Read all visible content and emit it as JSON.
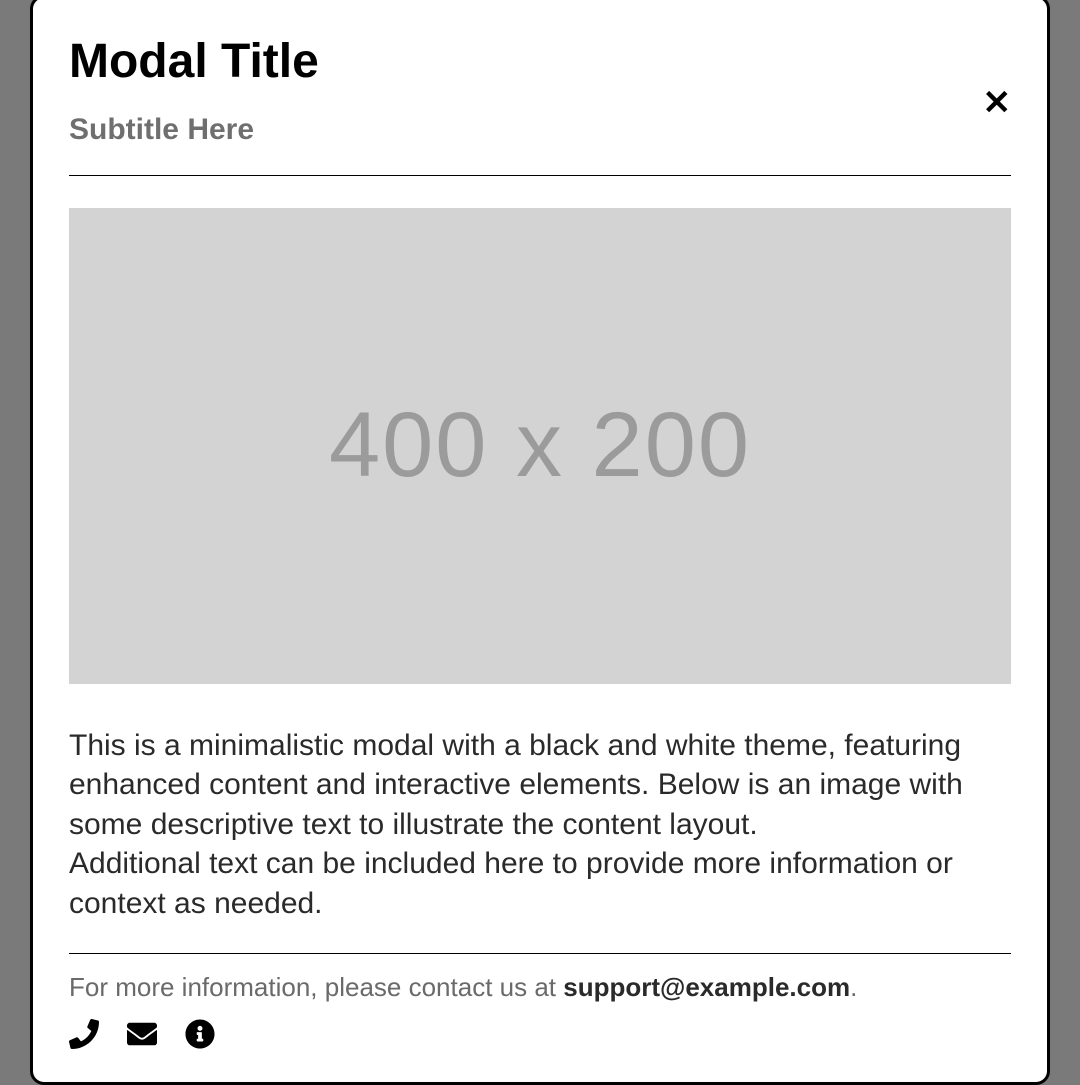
{
  "modal": {
    "title": "Modal Title",
    "subtitle": "Subtitle Here",
    "close_label": "✕",
    "image_placeholder": "400 x 200",
    "body_p1": "This is a minimalistic modal with a black and white theme, featuring enhanced content and interactive elements. Below is an image with some descriptive text to illustrate the content layout.",
    "body_p2": "Additional text can be included here to provide more information or context as needed.",
    "footer_prefix": "For more information, please contact us at ",
    "footer_email": "support@example.com",
    "footer_suffix": "."
  }
}
